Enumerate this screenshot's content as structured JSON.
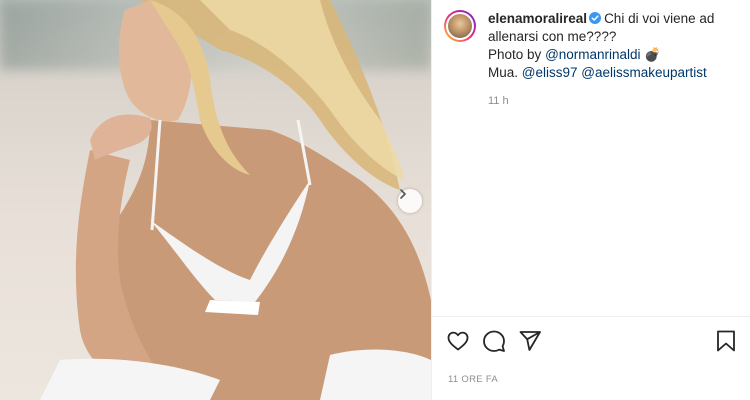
{
  "post": {
    "image_alt": "Photo by @normanrinaldi",
    "next_icon": "chevron-right-icon"
  },
  "comment": {
    "username": "elenamoralireal",
    "verified_icon": "verified-badge-icon",
    "caption_text": "Chi di voi viene ad allenarsi con me????",
    "photo_prefix": "Photo by",
    "photo_mention": "@normanrinaldi",
    "photo_emoji": "💣",
    "mua_prefix": "Mua.",
    "mua_mention_1": "@eliss97",
    "mua_mention_2": "@aelissmakeupartist",
    "time": "11 h"
  },
  "actions": {
    "like_icon": "heart-icon",
    "comment_icon": "comment-icon",
    "share_icon": "paper-plane-icon",
    "save_icon": "bookmark-icon"
  },
  "posted_label": "11 ore fa",
  "colors": {
    "text": "#262626",
    "mention": "#00376b",
    "muted": "#8e8e8e",
    "verified": "#3897f0"
  }
}
